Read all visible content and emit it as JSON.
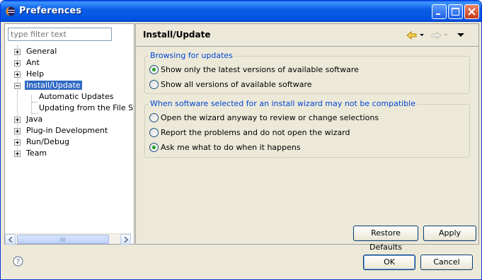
{
  "window": {
    "title": "Preferences"
  },
  "sidebar": {
    "filter_placeholder": "type filter text",
    "items": [
      {
        "label": "General",
        "expanded": false
      },
      {
        "label": "Ant",
        "expanded": false
      },
      {
        "label": "Help",
        "expanded": false
      },
      {
        "label": "Install/Update",
        "expanded": true,
        "selected": true,
        "children": [
          "Automatic Updates",
          "Updating from the File Syst"
        ]
      },
      {
        "label": "Java",
        "expanded": false
      },
      {
        "label": "Plug-in Development",
        "expanded": false
      },
      {
        "label": "Run/Debug",
        "expanded": false
      },
      {
        "label": "Team",
        "expanded": false
      }
    ]
  },
  "page": {
    "title": "Install/Update",
    "groups": [
      {
        "title": "Browsing for updates",
        "options": [
          {
            "label": "Show only the latest versions of available software",
            "checked": true
          },
          {
            "label": "Show all versions of available software",
            "checked": false
          }
        ]
      },
      {
        "title": "When software selected for an install wizard may not be compatible",
        "options": [
          {
            "label": "Open the wizard anyway to review or change selections",
            "checked": false
          },
          {
            "label": "Report the problems and do not open the wizard",
            "checked": false
          },
          {
            "label": "Ask me what to do when it happens",
            "checked": true
          }
        ]
      }
    ],
    "restore_defaults_label": "Restore Defaults",
    "apply_label": "Apply"
  },
  "footer": {
    "ok_label": "OK",
    "cancel_label": "Cancel"
  },
  "icons": {
    "window": "eclipse-icon",
    "back": "back-arrow-icon",
    "forward": "forward-arrow-icon",
    "menu": "view-menu-icon",
    "help": "help-icon"
  },
  "colors": {
    "titlebar": "#0a5fe5",
    "selection": "#316ac5",
    "group_title": "#0046d5",
    "radio_dot": "#21a121"
  }
}
